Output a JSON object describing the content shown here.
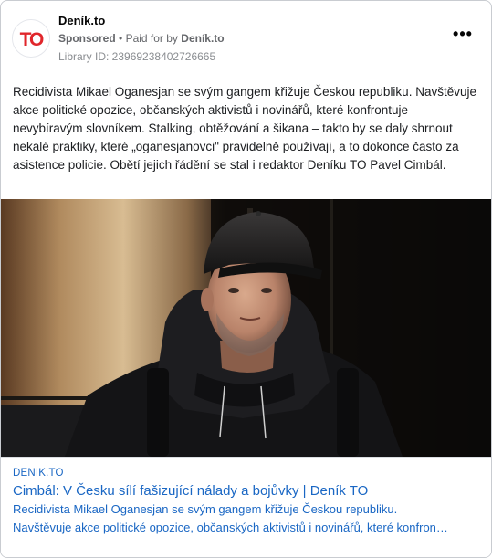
{
  "ad": {
    "page_name": "Deník.to",
    "sponsored_label": "Sponsored",
    "separator": "•",
    "paid_for_prefix": "Paid for by",
    "paid_for_by": "Deník.to",
    "library_id": "Library ID: 23969238402726665",
    "more_icon": "more-horizontal-icon",
    "more_label": "•••",
    "logo_text": "TO",
    "logo_color": "#e0262b"
  },
  "body": {
    "text": "Recidivista Mikael Oganesjan se svým gangem křižuje Českou republiku. Navštěvuje akce politické opozice, občanských aktivistů i novinářů, které konfrontuje nevybíravým slovníkem. Stalking, obtěžování a šikana – takto by se daly shrnout nekalé praktiky, které „oganesjanovci\" pravidelně používají, a to dokonce často za asistence policie. Obětí jejich řádění se stal i redaktor Deníku TO Pavel Cimbál."
  },
  "link": {
    "domain": "DENIK.TO",
    "title": "Cimbál: V Česku sílí fašizující nálady a bojůvky | Deník TO",
    "desc_line1": "Recidivista Mikael Oganesjan se svým gangem křižuje Českou republiku.",
    "desc_line2": "Navštěvuje akce politické opozice, občanských aktivistů i novinářů, které konfron…"
  },
  "colors": {
    "link_blue": "#1a67c4",
    "muted": "#65676b"
  }
}
